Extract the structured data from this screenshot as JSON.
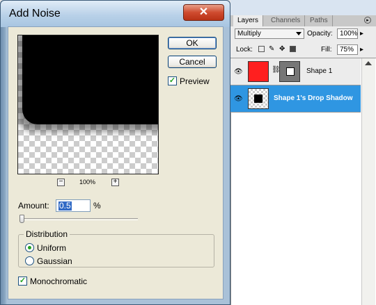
{
  "dialog": {
    "title": "Add Noise",
    "close_label": "✕",
    "ok_label": "OK",
    "cancel_label": "Cancel",
    "preview_label": "Preview",
    "preview_checked": true,
    "zoom_out_label": "−",
    "zoom_in_label": "+",
    "zoom_level": "100%",
    "amount_label": "Amount:",
    "amount_value": "0.5",
    "amount_unit": "%",
    "distribution_title": "Distribution",
    "distribution_options": [
      "Uniform",
      "Gaussian"
    ],
    "distribution_selected": "Uniform",
    "monochromatic_label": "Monochromatic",
    "monochromatic_checked": true
  },
  "layers_panel": {
    "tabs": [
      "Layers",
      "Channels",
      "Paths"
    ],
    "active_tab": "Layers",
    "blend_mode": "Multiply",
    "opacity_label": "Opacity:",
    "opacity_value": "100%",
    "lock_label": "Lock:",
    "fill_label": "Fill:",
    "fill_value": "75%",
    "layers": [
      {
        "name": "Shape 1",
        "selected": false,
        "thumb_color": "#ff1f1f"
      },
      {
        "name": "Shape 1's Drop Shadow",
        "selected": true
      }
    ]
  },
  "icons": {
    "eye": "eye-icon",
    "link": "chain-link-icon",
    "check": "checkmark-icon"
  },
  "colors": {
    "selection": "#316ac5",
    "layer_selected": "#2f96e2",
    "close_button": "#cf4b2f"
  }
}
